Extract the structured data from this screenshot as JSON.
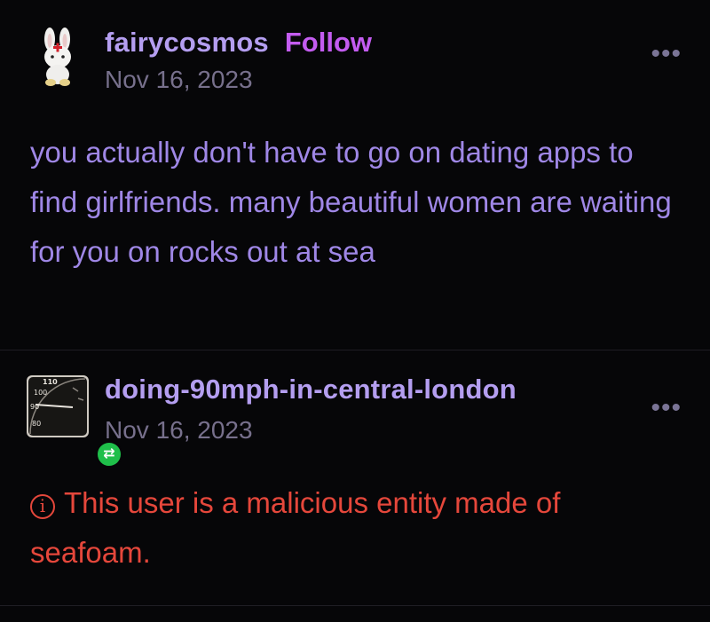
{
  "posts": [
    {
      "blog_name": "fairycosmos",
      "follow_label": "Follow",
      "date": "Nov 16, 2023",
      "more_label": "•••",
      "body": "you actually don't have to go on dating apps to find girlfriends. many beautiful women are waiting for you on rocks out at sea",
      "avatar_icon": "white-rabbit-avatar"
    },
    {
      "blog_name": "doing-90mph-in-central-london",
      "date": "Nov 16, 2023",
      "more_label": "•••",
      "info_icon_glyph": "i",
      "body": "This user is a malicious entity made of seafoam.",
      "reblog_glyph": "⇄",
      "avatar_icon": "speedometer-avatar",
      "speedometer_labels": [
        "110",
        "100",
        "90",
        "80"
      ]
    }
  ],
  "colors": {
    "background": "#060608",
    "blog_name": "#b49ef0",
    "follow": "#c35cf0",
    "date": "#77708c",
    "body": "#9f87e6",
    "warning": "#e5473b",
    "reblog_badge": "#1fbf4a"
  }
}
